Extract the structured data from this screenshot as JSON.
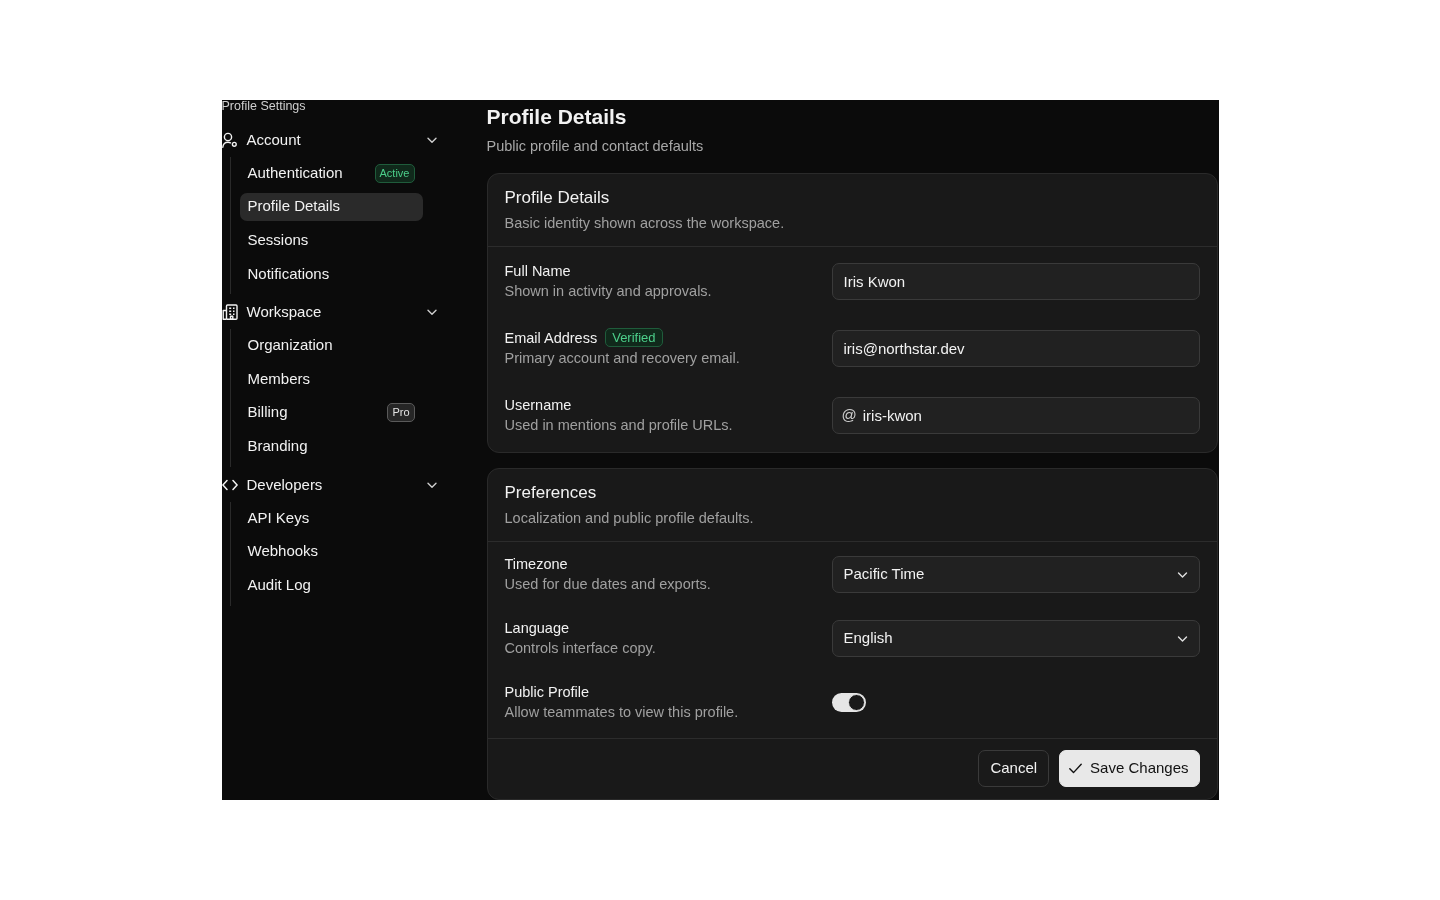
{
  "sidebar": {
    "title": "Profile Settings",
    "groups": [
      {
        "label": "Account",
        "expanded": true,
        "items": [
          {
            "label": "Authentication",
            "selected": false,
            "badge": {
              "text": "Active",
              "kind": "success"
            }
          },
          {
            "label": "Profile Details",
            "selected": true
          },
          {
            "label": "Sessions",
            "selected": false
          },
          {
            "label": "Notifications",
            "selected": false
          }
        ]
      },
      {
        "label": "Workspace",
        "expanded": true,
        "items": [
          {
            "label": "Organization",
            "selected": false
          },
          {
            "label": "Members",
            "selected": false
          },
          {
            "label": "Billing",
            "selected": false,
            "badge": {
              "text": "Pro",
              "kind": "neutral"
            }
          },
          {
            "label": "Branding",
            "selected": false
          }
        ]
      },
      {
        "label": "Developers",
        "expanded": true,
        "items": [
          {
            "label": "API Keys",
            "selected": false
          },
          {
            "label": "Webhooks",
            "selected": false
          },
          {
            "label": "Audit Log",
            "selected": false
          }
        ]
      }
    ]
  },
  "page": {
    "title": "Profile Details",
    "subtitle": "Public profile and contact defaults"
  },
  "sections": [
    {
      "title": "Profile Details",
      "description": "Basic identity shown across the workspace.",
      "fields": [
        {
          "kind": "text",
          "label": "Full Name",
          "description": "Shown in activity and approvals.",
          "value": "Iris Kwon"
        },
        {
          "kind": "text",
          "label": "Email Address",
          "badge": {
            "text": "Verified",
            "kind": "success"
          },
          "description": "Primary account and recovery email.",
          "value": "iris@northstar.dev"
        },
        {
          "kind": "text",
          "label": "Username",
          "description": "Used in mentions and profile URLs.",
          "prefix": "@",
          "value": "iris-kwon"
        }
      ]
    },
    {
      "title": "Preferences",
      "description": "Localization and public profile defaults.",
      "fields": [
        {
          "kind": "select",
          "label": "Timezone",
          "description": "Used for due dates and exports.",
          "value": "Pacific Time"
        },
        {
          "kind": "select",
          "label": "Language",
          "description": "Controls interface copy.",
          "value": "English"
        },
        {
          "kind": "toggle",
          "label": "Public Profile",
          "description": "Allow teammates to view this profile.",
          "on": true
        }
      ],
      "actions": [
        {
          "label": "Cancel",
          "kind": "secondary"
        },
        {
          "label": "Save Changes",
          "kind": "primary"
        }
      ]
    }
  ]
}
